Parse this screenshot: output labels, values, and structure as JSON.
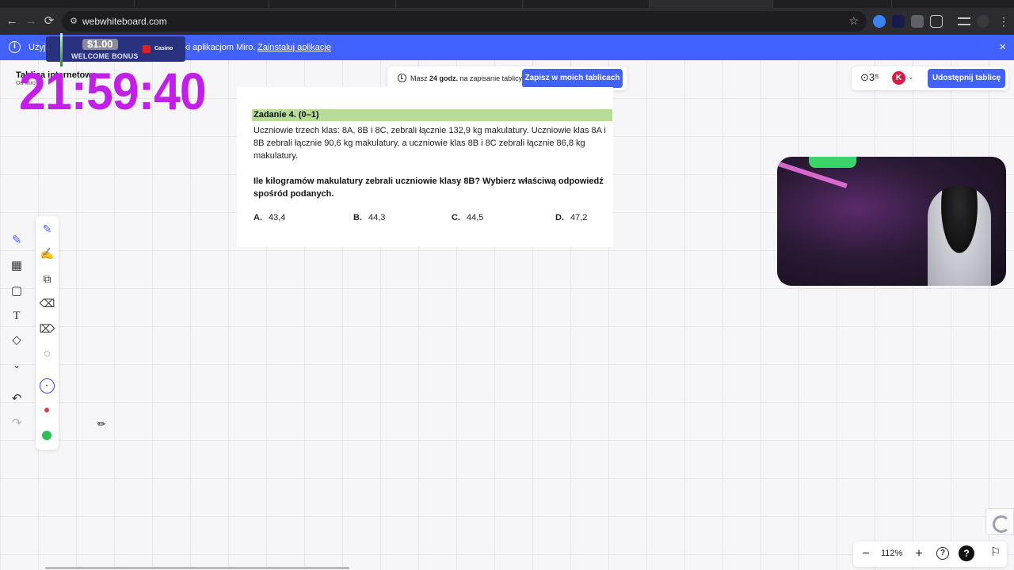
{
  "browser": {
    "url": "webwhiteboard.com",
    "back_icon": "←",
    "forward_icon": "→",
    "reload_icon": "⟳"
  },
  "banner": {
    "prefix": "Użyj",
    "text": "ki aplikacjom Miro.",
    "link": "Zainstaluj aplikacje",
    "close": "×"
  },
  "overlay": {
    "bonus_amount": "$1.00",
    "bonus_label": "WELCOME BONUS",
    "brand": "Casino",
    "timer": "21:59:40"
  },
  "board": {
    "name": "Tablica internetowa",
    "sub": "Od Miro"
  },
  "save": {
    "text_prefix": "Masz ",
    "hours": "24 godz.",
    "text_suffix": " na zapisanie tablicy.",
    "button": "Zapisz w moich tablicach"
  },
  "topright": {
    "reactions": "⊙3⁵",
    "avatar_letter": "K",
    "share_button": "Udostępnij tablicę"
  },
  "task": {
    "title": "Zadanie 4. (0–1)",
    "body": "Uczniowie trzech klas: 8A, 8B i 8C, zebrali łącznie  132,9 kg  makulatury. Uczniowie klas 8A i 8B zebrali łącznie  90,6 kg makulatury, a uczniowie klas 8B i 8C zebrali łącznie 86,8 kg makulatury.",
    "question": "Ile kilogramów makulatury zebrali uczniowie klasy 8B? Wybierz właściwą odpowiedź spośród podanych.",
    "options": [
      {
        "letter": "A.",
        "value": "43,4"
      },
      {
        "letter": "B.",
        "value": "44,3"
      },
      {
        "letter": "C.",
        "value": "44,5"
      },
      {
        "letter": "D.",
        "value": "47,2"
      }
    ]
  },
  "zoom": {
    "minus": "−",
    "value": "112%",
    "plus": "+",
    "help_outline": "?",
    "help_filled": "?",
    "flag": "⚐"
  }
}
